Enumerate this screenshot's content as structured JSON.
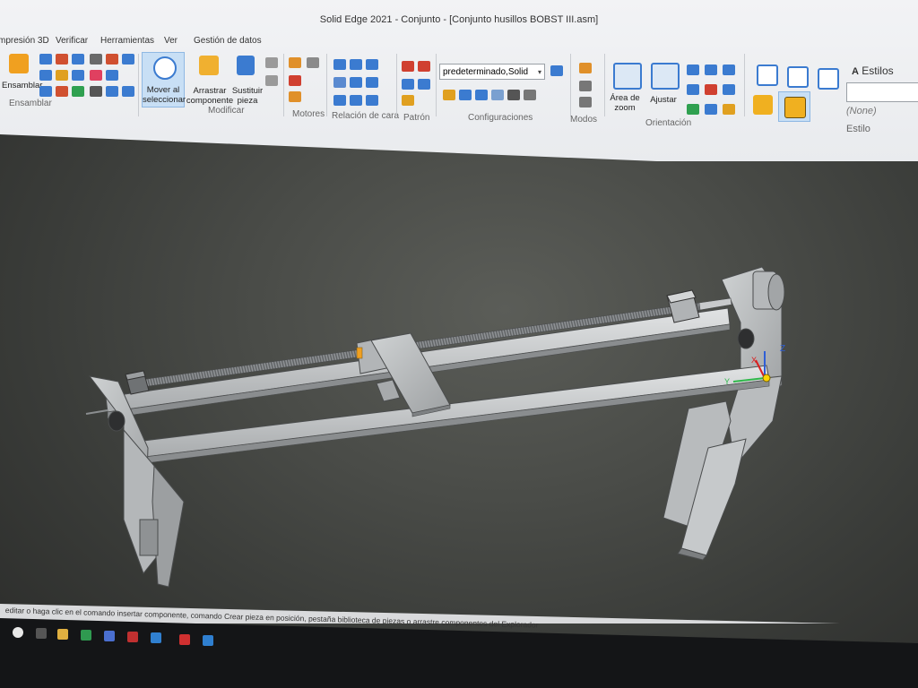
{
  "window": {
    "title": "Solid Edge 2021 - Conjunto - [Conjunto husillos BOBST III.asm]"
  },
  "tabs": [
    {
      "label": "mpresión 3D"
    },
    {
      "label": "Verificar"
    },
    {
      "label": "Herramientas"
    },
    {
      "label": "Ver"
    },
    {
      "label": "Gestión de datos"
    }
  ],
  "ribbon": {
    "ensamblar": {
      "button": "Ensamblar",
      "group": "Ensamblar"
    },
    "mover": {
      "button": "Mover al seleccionar"
    },
    "arrastrar": {
      "button": "Arrastrar componente"
    },
    "sustituir": {
      "button": "Sustituir pieza"
    },
    "modificar": {
      "group": "Modificar"
    },
    "motores": {
      "group": "Motores"
    },
    "relacion": {
      "group": "Relación de cara"
    },
    "patron": {
      "group": "Patrón"
    },
    "configuraciones": {
      "select_value": "predeterminado,Solid",
      "group": "Configuraciones"
    },
    "modos": {
      "group": "Modos"
    },
    "area_zoom": {
      "button": "Área de zoom"
    },
    "ajustar": {
      "button": "Ajustar"
    },
    "orientacion": {
      "group": "Orientación"
    },
    "estilos": {
      "button": "Estilos",
      "none_value": "(None)",
      "group": "Estilo"
    }
  },
  "status": {
    "prompt": "editar o haga clic en el comando insertar componente, comando Crear pieza en posición, pestaña biblioteca de piezas o arrastre componentes del Explorador"
  },
  "triad": {
    "x": "X",
    "y": "Y",
    "z": "Z"
  },
  "colors": {
    "ribbon_bg": "#eceef1",
    "viewport_bg": "#4a4c48",
    "part_fill": "#c4c7c9",
    "active_button": "#c8dff5",
    "accent_orange": "#f0a020",
    "accent_blue": "#2f7fd0"
  }
}
